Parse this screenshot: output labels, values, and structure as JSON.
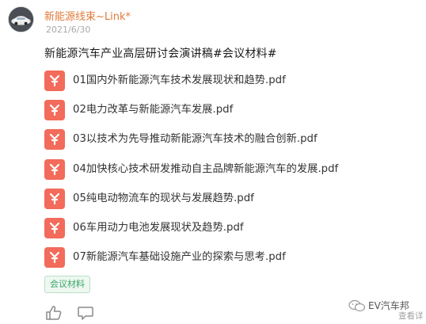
{
  "post": {
    "author": "新能源线束~Link*",
    "date": "2021/6/30",
    "title": "新能源汽车产业高层研讨会演讲稿#会议材料#",
    "files": [
      {
        "name": "01国内外新能源汽车技术发展现状和趋势.pdf",
        "icon": "pdf-icon"
      },
      {
        "name": "02电力改革与新能源汽车发展.pdf",
        "icon": "pdf-icon"
      },
      {
        "name": "03以技术为先导推动新能源汽车技术的融合创新.pdf",
        "icon": "pdf-icon"
      },
      {
        "name": "04加快核心技术研发推动自主品牌新能源汽车的发展.pdf",
        "icon": "pdf-icon"
      },
      {
        "name": "05纯电动物流车的现状与发展趋势.pdf",
        "icon": "pdf-icon"
      },
      {
        "name": "06车用动力电池发展现状及趋势.pdf",
        "icon": "pdf-icon"
      },
      {
        "name": "07新能源汽车基础设施产业的探索与思考.pdf",
        "icon": "pdf-icon"
      }
    ],
    "tag": "会议材料"
  },
  "actions": {
    "like_icon": "thumbs-up-icon",
    "comment_icon": "comment-icon"
  },
  "watermark": {
    "text": "EV汽车邦",
    "sub_text": "查看详"
  },
  "colors": {
    "author": "#e07a3a",
    "pdf_icon": "#f26b5b",
    "tag_text": "#3aa567",
    "tag_bg": "#eef8f1"
  }
}
